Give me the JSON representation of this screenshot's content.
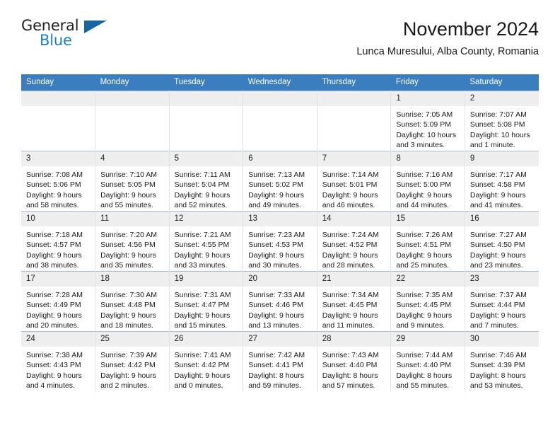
{
  "brand": {
    "word1": "General",
    "word2": "Blue",
    "logo_icon": "triangle-logo-icon",
    "accent_color": "#1b7fc4"
  },
  "header": {
    "title": "November 2024",
    "location": "Lunca Muresului, Alba County, Romania"
  },
  "calendar": {
    "header_bg": "#3a7ebf",
    "daynum_bg": "#eeeeee",
    "weekdays": [
      "Sunday",
      "Monday",
      "Tuesday",
      "Wednesday",
      "Thursday",
      "Friday",
      "Saturday"
    ],
    "weeks": [
      [
        {
          "day": "",
          "lines": []
        },
        {
          "day": "",
          "lines": []
        },
        {
          "day": "",
          "lines": []
        },
        {
          "day": "",
          "lines": []
        },
        {
          "day": "",
          "lines": []
        },
        {
          "day": "1",
          "lines": [
            "Sunrise: 7:05 AM",
            "Sunset: 5:09 PM",
            "Daylight: 10 hours",
            "and 3 minutes."
          ]
        },
        {
          "day": "2",
          "lines": [
            "Sunrise: 7:07 AM",
            "Sunset: 5:08 PM",
            "Daylight: 10 hours",
            "and 1 minute."
          ]
        }
      ],
      [
        {
          "day": "3",
          "lines": [
            "Sunrise: 7:08 AM",
            "Sunset: 5:06 PM",
            "Daylight: 9 hours",
            "and 58 minutes."
          ]
        },
        {
          "day": "4",
          "lines": [
            "Sunrise: 7:10 AM",
            "Sunset: 5:05 PM",
            "Daylight: 9 hours",
            "and 55 minutes."
          ]
        },
        {
          "day": "5",
          "lines": [
            "Sunrise: 7:11 AM",
            "Sunset: 5:04 PM",
            "Daylight: 9 hours",
            "and 52 minutes."
          ]
        },
        {
          "day": "6",
          "lines": [
            "Sunrise: 7:13 AM",
            "Sunset: 5:02 PM",
            "Daylight: 9 hours",
            "and 49 minutes."
          ]
        },
        {
          "day": "7",
          "lines": [
            "Sunrise: 7:14 AM",
            "Sunset: 5:01 PM",
            "Daylight: 9 hours",
            "and 46 minutes."
          ]
        },
        {
          "day": "8",
          "lines": [
            "Sunrise: 7:16 AM",
            "Sunset: 5:00 PM",
            "Daylight: 9 hours",
            "and 44 minutes."
          ]
        },
        {
          "day": "9",
          "lines": [
            "Sunrise: 7:17 AM",
            "Sunset: 4:58 PM",
            "Daylight: 9 hours",
            "and 41 minutes."
          ]
        }
      ],
      [
        {
          "day": "10",
          "lines": [
            "Sunrise: 7:18 AM",
            "Sunset: 4:57 PM",
            "Daylight: 9 hours",
            "and 38 minutes."
          ]
        },
        {
          "day": "11",
          "lines": [
            "Sunrise: 7:20 AM",
            "Sunset: 4:56 PM",
            "Daylight: 9 hours",
            "and 35 minutes."
          ]
        },
        {
          "day": "12",
          "lines": [
            "Sunrise: 7:21 AM",
            "Sunset: 4:55 PM",
            "Daylight: 9 hours",
            "and 33 minutes."
          ]
        },
        {
          "day": "13",
          "lines": [
            "Sunrise: 7:23 AM",
            "Sunset: 4:53 PM",
            "Daylight: 9 hours",
            "and 30 minutes."
          ]
        },
        {
          "day": "14",
          "lines": [
            "Sunrise: 7:24 AM",
            "Sunset: 4:52 PM",
            "Daylight: 9 hours",
            "and 28 minutes."
          ]
        },
        {
          "day": "15",
          "lines": [
            "Sunrise: 7:26 AM",
            "Sunset: 4:51 PM",
            "Daylight: 9 hours",
            "and 25 minutes."
          ]
        },
        {
          "day": "16",
          "lines": [
            "Sunrise: 7:27 AM",
            "Sunset: 4:50 PM",
            "Daylight: 9 hours",
            "and 23 minutes."
          ]
        }
      ],
      [
        {
          "day": "17",
          "lines": [
            "Sunrise: 7:28 AM",
            "Sunset: 4:49 PM",
            "Daylight: 9 hours",
            "and 20 minutes."
          ]
        },
        {
          "day": "18",
          "lines": [
            "Sunrise: 7:30 AM",
            "Sunset: 4:48 PM",
            "Daylight: 9 hours",
            "and 18 minutes."
          ]
        },
        {
          "day": "19",
          "lines": [
            "Sunrise: 7:31 AM",
            "Sunset: 4:47 PM",
            "Daylight: 9 hours",
            "and 15 minutes."
          ]
        },
        {
          "day": "20",
          "lines": [
            "Sunrise: 7:33 AM",
            "Sunset: 4:46 PM",
            "Daylight: 9 hours",
            "and 13 minutes."
          ]
        },
        {
          "day": "21",
          "lines": [
            "Sunrise: 7:34 AM",
            "Sunset: 4:45 PM",
            "Daylight: 9 hours",
            "and 11 minutes."
          ]
        },
        {
          "day": "22",
          "lines": [
            "Sunrise: 7:35 AM",
            "Sunset: 4:45 PM",
            "Daylight: 9 hours",
            "and 9 minutes."
          ]
        },
        {
          "day": "23",
          "lines": [
            "Sunrise: 7:37 AM",
            "Sunset: 4:44 PM",
            "Daylight: 9 hours",
            "and 7 minutes."
          ]
        }
      ],
      [
        {
          "day": "24",
          "lines": [
            "Sunrise: 7:38 AM",
            "Sunset: 4:43 PM",
            "Daylight: 9 hours",
            "and 4 minutes."
          ]
        },
        {
          "day": "25",
          "lines": [
            "Sunrise: 7:39 AM",
            "Sunset: 4:42 PM",
            "Daylight: 9 hours",
            "and 2 minutes."
          ]
        },
        {
          "day": "26",
          "lines": [
            "Sunrise: 7:41 AM",
            "Sunset: 4:42 PM",
            "Daylight: 9 hours",
            "and 0 minutes."
          ]
        },
        {
          "day": "27",
          "lines": [
            "Sunrise: 7:42 AM",
            "Sunset: 4:41 PM",
            "Daylight: 8 hours",
            "and 59 minutes."
          ]
        },
        {
          "day": "28",
          "lines": [
            "Sunrise: 7:43 AM",
            "Sunset: 4:40 PM",
            "Daylight: 8 hours",
            "and 57 minutes."
          ]
        },
        {
          "day": "29",
          "lines": [
            "Sunrise: 7:44 AM",
            "Sunset: 4:40 PM",
            "Daylight: 8 hours",
            "and 55 minutes."
          ]
        },
        {
          "day": "30",
          "lines": [
            "Sunrise: 7:46 AM",
            "Sunset: 4:39 PM",
            "Daylight: 8 hours",
            "and 53 minutes."
          ]
        }
      ]
    ]
  }
}
